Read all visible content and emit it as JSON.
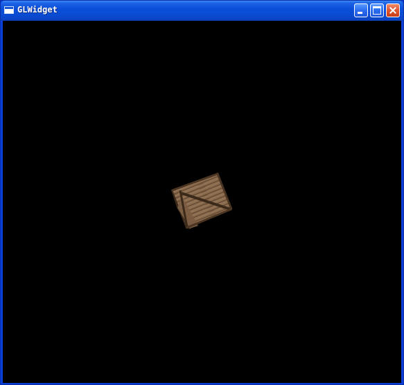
{
  "window": {
    "title": "GLWidget",
    "icon": "window-icon"
  },
  "controls": {
    "minimize": "minimize-icon",
    "maximize": "maximize-icon",
    "close": "close-icon"
  },
  "scene": {
    "background_color": "#000000",
    "object": "textured-wooden-crate",
    "wood_colors": [
      "#8a6a4c",
      "#6f5238",
      "#a68566",
      "#3a2818"
    ]
  }
}
